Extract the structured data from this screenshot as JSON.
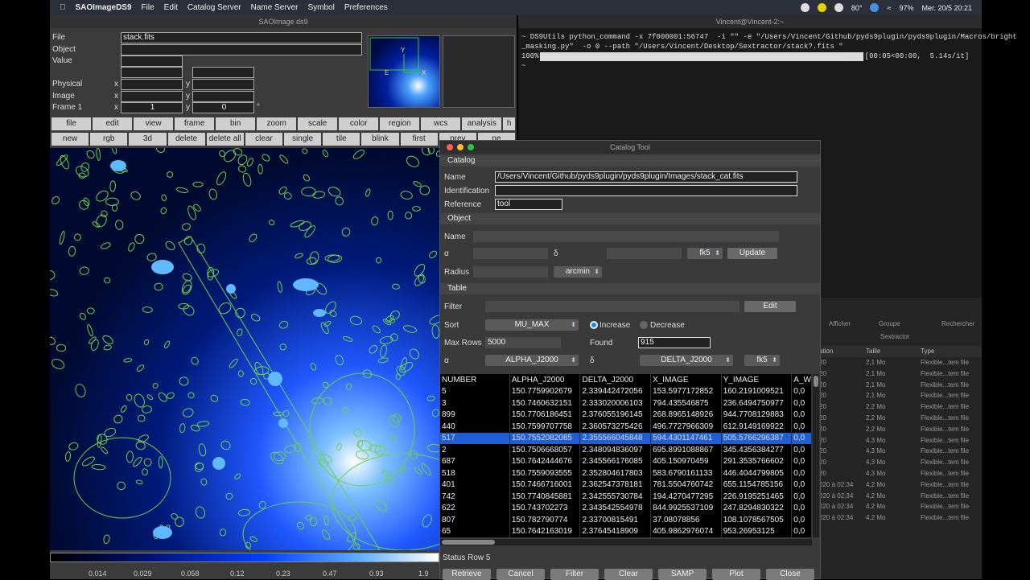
{
  "menubar": {
    "app": "SAOImageDS9",
    "items": [
      "File",
      "Edit",
      "Catalog Server",
      "Name Server",
      "Symbol",
      "Preferences"
    ],
    "status": [
      "80°",
      "97%",
      "Mer. 20/5 20:21"
    ]
  },
  "ds9": {
    "title": "SAOImage ds9",
    "file_label": "File",
    "file_value": "stack.fits",
    "object_label": "Object",
    "value_label": "Value",
    "physical_label": "Physical",
    "image_label": "Image",
    "frame_label": "Frame 1",
    "x": "x",
    "y": "y",
    "frame_x": "1",
    "frame_y": "0",
    "deg": "°",
    "buttons1": [
      "file",
      "edit",
      "view",
      "frame",
      "bin",
      "zoom",
      "scale",
      "color",
      "region",
      "wcs",
      "analysis",
      "h"
    ],
    "buttons2": [
      "new",
      "rgb",
      "3d",
      "delete",
      "delete all",
      "clear",
      "single",
      "tile",
      "blink",
      "first",
      "prev",
      "ne"
    ],
    "ticks": [
      "0.014",
      "0.029",
      "0.058",
      "0.12",
      "0.23",
      "0.47",
      "0.93",
      "1.9"
    ]
  },
  "terminal": {
    "title": "Vincent@Vincent-2:~",
    "lines": [
      "~ DS9Utils python_command -x 7f000001:56747  -i \"\" -e \"/Users/Vincent/Github/pyds9plugin/pyds9plugin/Macros/bright",
      "_masking.py\"  -o 0 --path \"/Users/Vincent/Desktop/Sextractor/stack?.fits \"",
      "100%|                                                                    | 1/1 [00:05<00:00,  5.14s/it]",
      "~ "
    ]
  },
  "finder": {
    "tabs": [
      "Afficher",
      "Groupe",
      "Rechercher"
    ],
    "folder": "Sextractor",
    "cols": [
      "ation",
      "Taille",
      "Type"
    ],
    "rows": [
      [
        "20",
        "2,1 Mo",
        "Flexible...tem file"
      ],
      [
        "20",
        "2,1 Mo",
        "Flexible...tem file"
      ],
      [
        "20",
        "2,1 Mo",
        "Flexible...tem file"
      ],
      [
        "20",
        "2,1 Mo",
        "Flexible...tem file"
      ],
      [
        "20",
        "2,2 Mo",
        "Flexible...tem file"
      ],
      [
        "20",
        "2,2 Mo",
        "Flexible...tem file"
      ],
      [
        "20",
        "2,2 Mo",
        "Flexible...tem file"
      ],
      [
        "20",
        "4,3 Mo",
        "Flexible...tem file"
      ],
      [
        "20",
        "4,3 Mo",
        "Flexible...tem file"
      ],
      [
        "20",
        "4,3 Mo",
        "Flexible...tem file"
      ],
      [
        "20",
        "4,3 Mo",
        "Flexible...tem file"
      ],
      [
        "020 à 02:34",
        "4,2 Mo",
        "Flexible...tem file"
      ],
      [
        "020 à 02:34",
        "4,2 Mo",
        "Flexible...tem file"
      ],
      [
        "020 à 02:34",
        "4,2 Mo",
        "Flexible...tem file"
      ],
      [
        "020 à 02:34",
        "4,2 Mo",
        "Flexible...tem file"
      ]
    ]
  },
  "cat": {
    "title": "Catalog Tool",
    "catalog": "Catalog",
    "name_label": "Name",
    "name_value": "/Users/Vincent/Github/pyds9plugin/pyds9plugin/Images/stack_cat.fits",
    "ident_label": "Identification",
    "ref_label": "Reference",
    "ref_value": "tool",
    "object": "Object",
    "obj_name": "Name",
    "alpha": "α",
    "delta": "δ",
    "fk5": "fk5",
    "update": "Update",
    "radius": "Radius",
    "arcmin": "arcmin",
    "table": "Table",
    "filter": "Filter",
    "edit": "Edit",
    "sort": "Sort",
    "sort_value": "MU_MAX",
    "increase": "Increase",
    "decrease": "Decrease",
    "maxrows_label": "Max Rows",
    "maxrows": "5000",
    "found_label": "Found",
    "found": "915",
    "alpha_col": "ALPHA_J2000",
    "delta_col": "DELTA_J2000",
    "cols": [
      "NUMBER",
      "ALPHA_J2000",
      "DELTA_J2000",
      "X_IMAGE",
      "Y_IMAGE",
      "A_W"
    ],
    "rows": [
      [
        "5",
        "150.7759902679",
        "2.339442472056",
        "153.5977172852",
        "160.2191009521",
        "0,0"
      ],
      [
        "3",
        "150.7460632151",
        "2.333020006103",
        "794.435546875",
        "236.6494750977",
        "0,0"
      ],
      [
        "899",
        "150.7706186451",
        "2.376055196145",
        "268.8965148926",
        "944.7708129883",
        "0,0"
      ],
      [
        "440",
        "150.7599707758",
        "2.360573275426",
        "496.7727966309",
        "612.9149169922",
        "0,0"
      ],
      [
        "517",
        "150.7552082085",
        "2.355566045848",
        "594.4301147461",
        "505.5766296387",
        "0,0"
      ],
      [
        "2",
        "150.7506668057",
        "2.348094836097",
        "695.8991088867",
        "345.4356384277",
        "0,0"
      ],
      [
        "687",
        "150.7642444676",
        "2.345566176085",
        "405.150970459",
        "291.3535766602",
        "0,0"
      ],
      [
        "518",
        "150.7559093555",
        "2.352804617803",
        "583.6790161133",
        "446.4044799805",
        "0,0"
      ],
      [
        "401",
        "150.7466716001",
        "2.362547378181",
        "781.5504760742",
        "655.1154785156",
        "0,0"
      ],
      [
        "742",
        "150.7740845881",
        "2.342555730784",
        "194.4270477295",
        "226.9195251465",
        "0,0"
      ],
      [
        "622",
        "150.743702273",
        "2.343542554978",
        "844.9925537109",
        "247.8294830322",
        "0,0"
      ],
      [
        "807",
        "150.782790774",
        "2.33700815491",
        "37.08078856",
        "108.1078567505",
        "0,0"
      ],
      [
        "65",
        "150.7642163019",
        "2.37645418909",
        "405.9862976074",
        "953.26953125",
        "0,0"
      ]
    ],
    "status": "Status  Row 5",
    "buttons": [
      "Retrieve",
      "Cancel",
      "Filter",
      "Clear",
      "SAMP",
      "Plot",
      "Close"
    ]
  },
  "colors": {
    "selection": "#1e5fd8",
    "regions": "#6fcf4f"
  }
}
